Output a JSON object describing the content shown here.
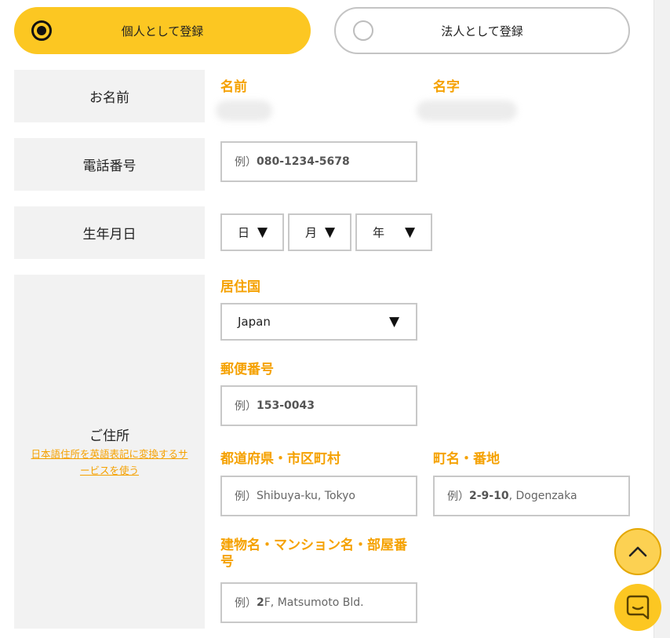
{
  "registration_type": {
    "individual_label": "個人として登録",
    "corporate_label": "法人として登録"
  },
  "name": {
    "section_label": "お名前",
    "first_name_label": "名前",
    "last_name_label": "名字"
  },
  "phone": {
    "section_label": "電話番号",
    "placeholder_prefix": "例）",
    "placeholder_value": "080-1234-5678"
  },
  "birthday": {
    "section_label": "生年月日",
    "day": "日",
    "month": "月",
    "year": "年"
  },
  "address": {
    "section_label": "ご住所",
    "convert_link": "日本語住所を英語表記に変換するサービスを使う",
    "country_label": "居住国",
    "country_value": "Japan",
    "postal_label": "郵便番号",
    "postal_prefix": "例）",
    "postal_value": "153-0043",
    "city_label": "都道府県・市区町村",
    "city_prefix": "例）",
    "city_value": "Shibuya-ku, Tokyo",
    "street_label": "町名・番地",
    "street_prefix": "例）",
    "street_bold": "2-9-10",
    "street_rest": ", Dogenzaka",
    "building_label": "建物名・マンション名・部屋番号",
    "building_prefix": "例）",
    "building_bold": "2",
    "building_rest": "F, Matsumoto Bld."
  },
  "icons": {
    "dropdown": "▼",
    "scroll_top": "chevron-up-icon",
    "chat": "chat-icon"
  },
  "colors": {
    "accent": "#fcc722",
    "label_orange": "#f5a100"
  }
}
